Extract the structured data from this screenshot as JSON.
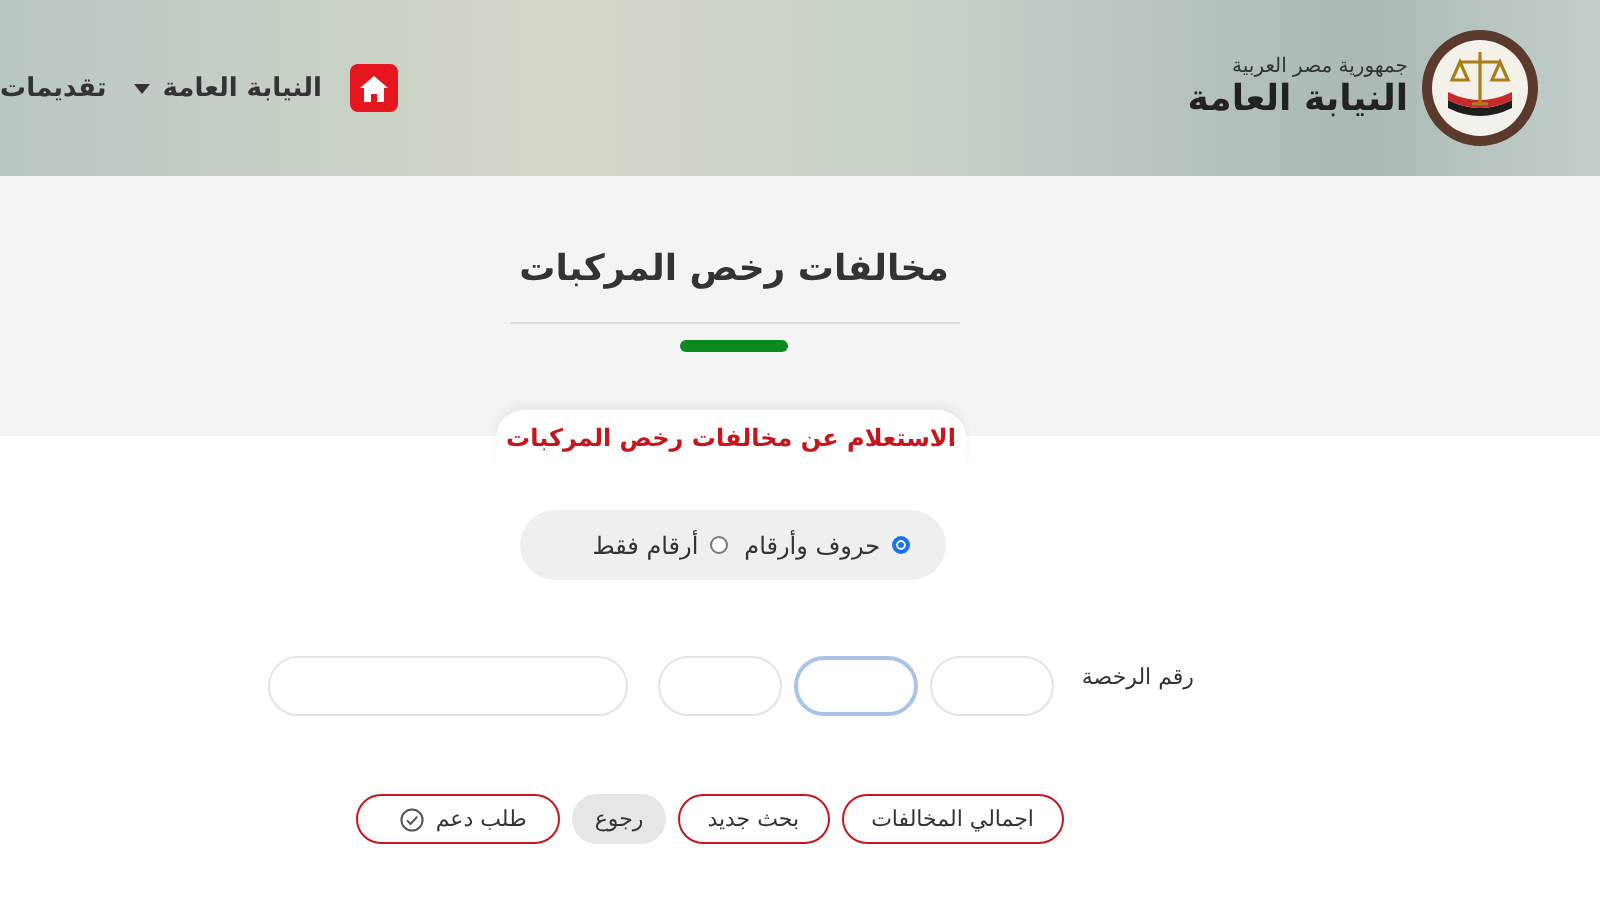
{
  "header": {
    "country": "جمهورية مصر العربية",
    "site_name": "النيابة العامة",
    "nav": [
      {
        "label": "النيابة العامة",
        "dropdown": true
      },
      {
        "label": "تقديمات",
        "dropdown": false
      }
    ]
  },
  "page_title": "مخالفات رخص المركبات",
  "form": {
    "tab_label": "الاستعلام عن مخالفات رخص المركبات",
    "options": [
      {
        "label": "حروف وأرقام",
        "selected": true
      },
      {
        "label": "أرقام فقط",
        "selected": false
      }
    ],
    "license_label": "رقم الرخصة",
    "fields": [
      {
        "focused": false
      },
      {
        "focused": true
      },
      {
        "focused": false
      },
      {
        "focused": false,
        "kind": "wide"
      }
    ],
    "buttons": [
      {
        "label": "اجمالي المخالفات",
        "kind": "outline"
      },
      {
        "label": "بحث جديد",
        "kind": "outline"
      },
      {
        "label": "رجوع",
        "kind": "grey"
      },
      {
        "label": "طلب دعم",
        "kind": "check"
      }
    ]
  }
}
